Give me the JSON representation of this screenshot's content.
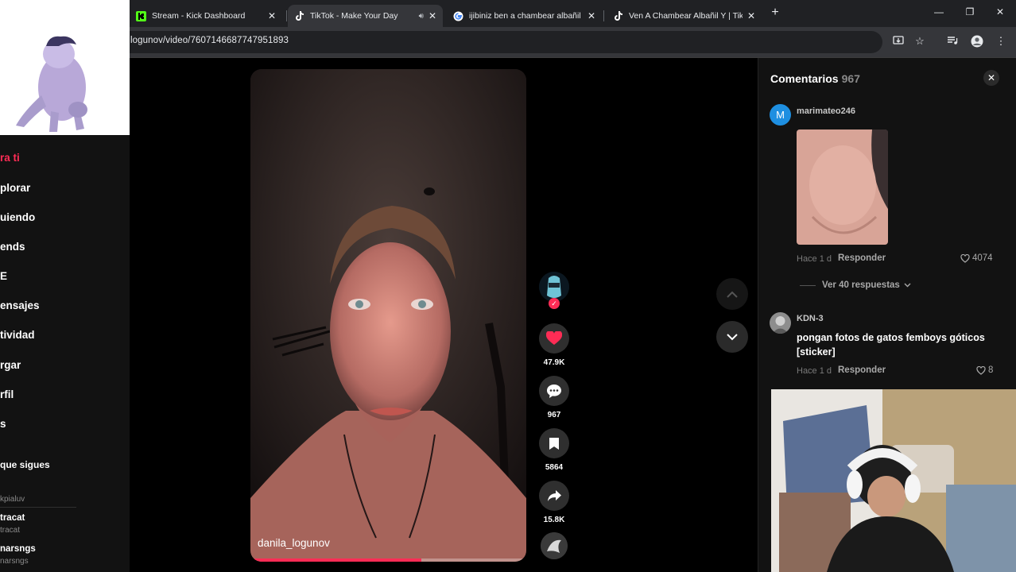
{
  "browser": {
    "tabs": [
      {
        "title": "Stream - Kick Dashboard",
        "favicon": "kick-icon"
      },
      {
        "title": "TikTok - Make Your Day",
        "favicon": "tiktok-icon",
        "active": true
      },
      {
        "title": "ijibiniz ben a chambear albañil",
        "favicon": "google-icon"
      },
      {
        "title": "Ven A Chambear Albañil Y | Tik",
        "favicon": "tiktok-icon"
      }
    ],
    "url": "logunov/video/7607146687747951893"
  },
  "left_nav": {
    "items": [
      "ra ti",
      "plorar",
      "uiendo",
      "ends",
      "E",
      "ensajes",
      "tividad",
      "rgar",
      "rfil",
      "s"
    ],
    "following_header": "que sigues",
    "accounts": [
      {
        "name": "",
        "handle": "kpialuv"
      },
      {
        "name": "tracat",
        "handle": "tracat"
      },
      {
        "name": "narsngs",
        "handle": "narsngs"
      }
    ]
  },
  "video": {
    "author": "danila_logunov",
    "progress_percent": 62
  },
  "actions": {
    "likes": "47.9K",
    "comments": "967",
    "saves": "5864",
    "shares": "15.8K"
  },
  "comments_panel": {
    "title": "Comentarios",
    "count": "967",
    "items": [
      {
        "avatar_letter": "M",
        "avatar_color": "#1e8fe1",
        "user": "marimateo246",
        "text": "",
        "time": "Hace 1 d",
        "reply": "Responder",
        "likes": "4074",
        "more": "Ver 40 respuestas"
      },
      {
        "avatar_letter": "",
        "avatar_color": "#8d8d8d",
        "user": "KDN-3",
        "text": "pongan fotos de gatos femboys góticos [sticker]",
        "time": "Hace 1 d",
        "reply": "Responder",
        "likes": "8"
      }
    ]
  },
  "colors": {
    "accent": "#fe2c55",
    "panel": "#121212",
    "chrome": "#202124"
  }
}
